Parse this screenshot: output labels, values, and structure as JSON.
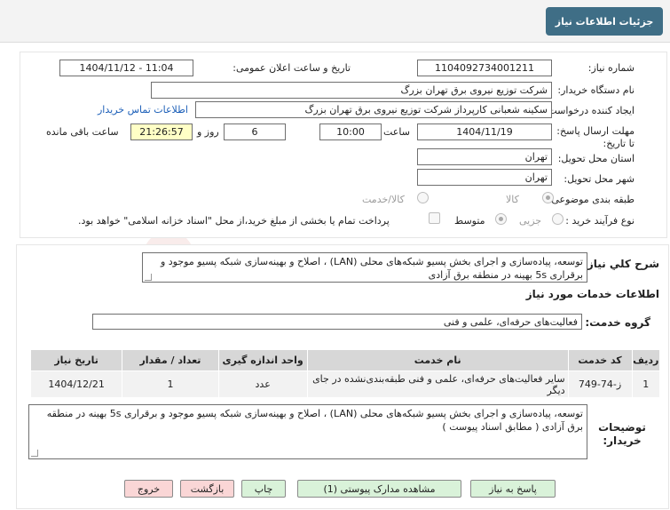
{
  "header": {
    "title": "جزئیات اطلاعات نیاز"
  },
  "fields": {
    "need_number": {
      "label": "شماره نیاز:",
      "value": "1104092734001211"
    },
    "announce_datetime": {
      "label": "تاریخ و ساعت اعلان عمومی:",
      "value": "1404/11/12 - 11:04"
    },
    "buyer_org": {
      "label": "نام دستگاه خریدار:",
      "value": "شرکت توزیع نیروی برق تهران بزرگ"
    },
    "requester": {
      "label": "ایجاد کننده درخواست:",
      "value": "سکینه شعبانی کارپرداز شرکت توزیع نیروی برق تهران بزرگ",
      "contact_link": "اطلاعات تماس خریدار"
    },
    "deadline": {
      "label": "مهلت ارسال پاسخ: تا تاریخ:",
      "date": "1404/11/19",
      "time_label": "ساعت",
      "time": "10:00",
      "days": "6",
      "days_label": "روز و",
      "remaining": "21:26:57",
      "remaining_label": "ساعت باقی مانده"
    },
    "province": {
      "label": "استان محل تحویل:",
      "value": "تهران"
    },
    "city": {
      "label": "شهر محل تحویل:",
      "value": "تهران"
    },
    "category": {
      "label": "طبقه بندی موضوعی:",
      "options": [
        "کالا",
        "کالا/خدمت"
      ],
      "selected": "کالا"
    },
    "purchase_type": {
      "label": "نوع فرآیند خرید :",
      "options": [
        "جزیی",
        "متوسط"
      ],
      "selected": "متوسط",
      "note": "پرداخت تمام یا بخشی از مبلغ خرید،از محل \"اسناد خزانه اسلامی\" خواهد بود."
    }
  },
  "description": {
    "label": "شرح کلي نياز:",
    "text": "توسعه، پیاده‌سازی و اجرای بخش پسیو شبکه‌های محلی (LAN) ، اصلاح و بهینه‌سازی شبکه پسیو موجود و برقراری 5s بهینه در منطقه برق آزادی"
  },
  "services": {
    "section_title": "اطلاعات خدمات مورد نیاز",
    "group_label": "گروه خدمت:",
    "group_value": "فعالیت‌های حرفه‌ای، علمی و فنی",
    "columns": [
      "ردیف",
      "کد خدمت",
      "نام خدمت",
      "واحد اندازه گیری",
      "تعداد / مقدار",
      "تاریخ نیاز"
    ],
    "rows": [
      [
        "1",
        "ز-74-749",
        "سایر فعالیت‌های حرفه‌ای، علمی و فنی طبقه‌بندی‌نشده در جای دیگر",
        "عدد",
        "1",
        "1404/12/21"
      ]
    ]
  },
  "buyer_notes": {
    "label": "توضیحات خریدار:",
    "text": "توسعه، پیاده‌سازی و اجرای بخش پسیو شبکه‌های محلی (LAN) ، اصلاح و بهینه‌سازی شبکه پسیو موجود و برقراری 5s بهینه در منطقه برق آزادی  ( مطابق اسناد پیوست )"
  },
  "buttons": {
    "reply": "پاسخ به نیاز",
    "view_docs": "مشاهده مدارک پیوستی (1)",
    "print": "چاپ",
    "back": "بازگشت",
    "exit": "خروج"
  },
  "watermark": {
    "text": "AriaTender.net"
  },
  "colors": {
    "header_button": "#3f6e86",
    "time_highlight": "#ffffc6",
    "green_button": "#d9f2d9",
    "pink_button": "#fad6d6",
    "link": "#1c5fb8"
  }
}
